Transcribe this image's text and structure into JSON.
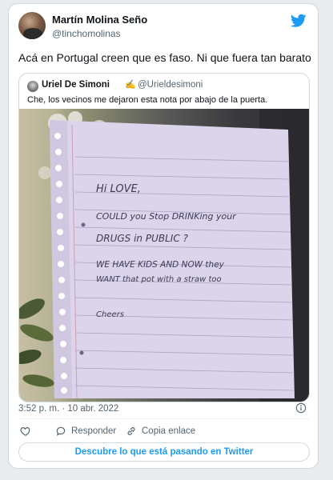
{
  "tweet": {
    "author_name": "Martín Molina Seño",
    "author_handle": "@tinchomolinas",
    "text": "Acá en Portugal creen que es faso. Ni que fuera tan barato",
    "timestamp": "3:52 p. m. · 10 abr. 2022"
  },
  "quoted": {
    "author_name": "Uriel De Simoni",
    "author_handle": "@Urieldesimoni",
    "text": "Che, los vecinos me dejaron esta nota por abajo de la puerta.",
    "photo": {
      "note_lines": [
        "Hi LOVE,",
        "COULD you Stop DRINKing your",
        "DRUGS in PUBLIC ?",
        "WE HAVE KIDS AND NOW they",
        "WANT that pot with a straw too",
        "Cheers"
      ]
    }
  },
  "actions": {
    "like_label": "",
    "reply_label": "Responder",
    "copy_link_label": "Copia enlace"
  },
  "cta": {
    "label": "Descubre lo que está pasando en Twitter"
  },
  "icons": {
    "twitter": "twitter-bird-icon",
    "info": "info-icon",
    "like": "heart-icon",
    "reply": "reply-bubble-icon",
    "copy_link": "link-icon"
  },
  "colors": {
    "accent": "#1d9bf0",
    "text": "#0f1419",
    "muted": "#536471",
    "border": "#cfd9de"
  }
}
